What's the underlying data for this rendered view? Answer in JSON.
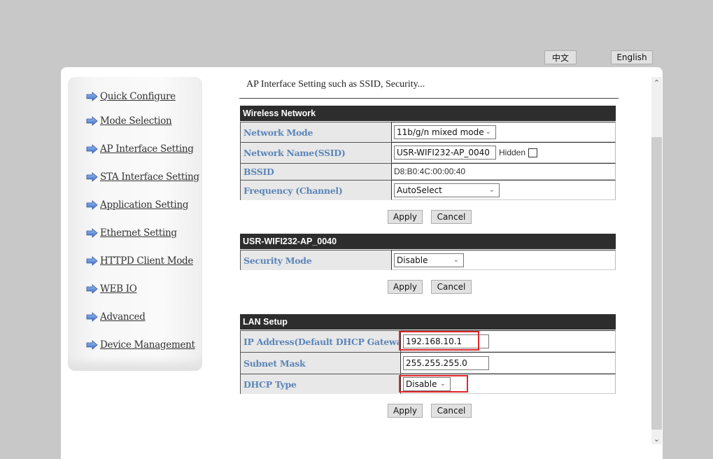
{
  "language": {
    "zh": "中文",
    "en": "English"
  },
  "sidebar": {
    "items": [
      {
        "label": "Quick Configure"
      },
      {
        "label": "Mode Selection"
      },
      {
        "label": "AP Interface Setting"
      },
      {
        "label": "STA Interface Setting"
      },
      {
        "label": "Application Setting"
      },
      {
        "label": "Ethernet Setting"
      },
      {
        "label": "HTTPD Client Mode"
      },
      {
        "label": "WEB IO"
      },
      {
        "label": "Advanced"
      },
      {
        "label": "Device Management"
      }
    ]
  },
  "main": {
    "intro": "AP Interface Setting such as SSID, Security...",
    "wireless": {
      "title": "Wireless Network",
      "network_mode": {
        "label": "Network Mode",
        "value": "11b/g/n mixed mode"
      },
      "ssid": {
        "label": "Network Name(SSID)",
        "value": "USR-WIFI232-AP_0040",
        "hidden_label": "Hidden",
        "hidden_checked": false
      },
      "bssid": {
        "label": "BSSID",
        "value": "D8:B0:4C:00:00:40"
      },
      "channel": {
        "label": "Frequency (Channel)",
        "value": "AutoSelect"
      },
      "apply": "Apply",
      "cancel": "Cancel"
    },
    "security": {
      "title": "USR-WIFI232-AP_0040",
      "mode": {
        "label": "Security Mode",
        "value": "Disable"
      },
      "apply": "Apply",
      "cancel": "Cancel"
    },
    "lan": {
      "title": "LAN Setup",
      "ip": {
        "label": "IP Address(Default DHCP Gateway)",
        "value": "192.168.10.1"
      },
      "mask": {
        "label": "Subnet Mask",
        "value": "255.255.255.0"
      },
      "dhcp": {
        "label": "DHCP Type",
        "value": "Disable"
      },
      "apply": "Apply",
      "cancel": "Cancel"
    }
  },
  "colors": {
    "label_text": "#5b85b8",
    "section_header_bg": "#2d2d2d",
    "highlight": "#e3262b"
  }
}
